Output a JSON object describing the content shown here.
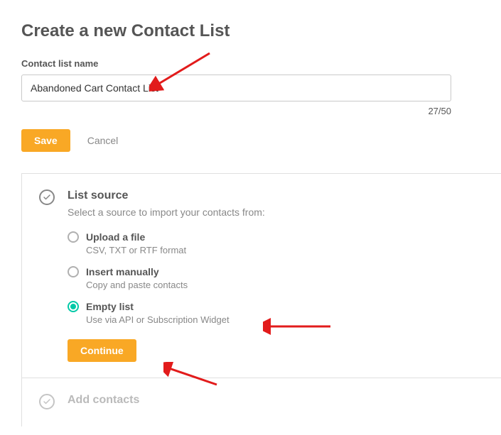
{
  "page_title": "Create a new Contact List",
  "name_field": {
    "label": "Contact list name",
    "value": "Abandoned Cart Contact List",
    "counter": "27/50"
  },
  "actions": {
    "save": "Save",
    "cancel": "Cancel"
  },
  "steps": {
    "source": {
      "title": "List source",
      "subtitle": "Select a source to import your contacts from:",
      "options": [
        {
          "label": "Upload a file",
          "desc": "CSV, TXT or RTF format",
          "selected": false
        },
        {
          "label": "Insert manually",
          "desc": "Copy and paste contacts",
          "selected": false
        },
        {
          "label": "Empty list",
          "desc": "Use via API or Subscription Widget",
          "selected": true
        }
      ],
      "continue": "Continue"
    },
    "add_contacts": {
      "title": "Add contacts"
    }
  }
}
